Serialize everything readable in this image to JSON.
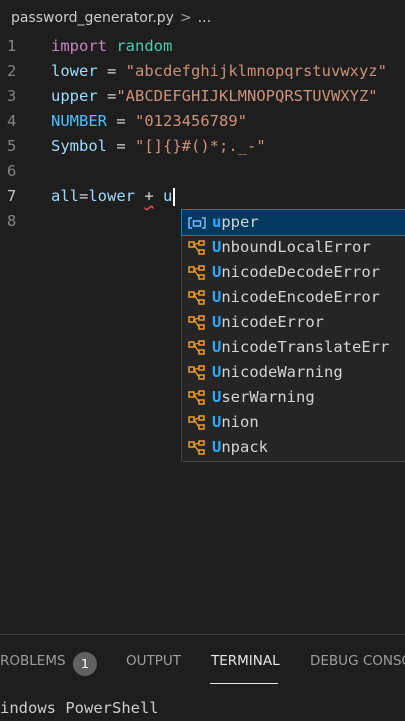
{
  "breadcrumb": {
    "file": "password_generator.py",
    "separator": ">",
    "more": "..."
  },
  "editor": {
    "lines": [
      {
        "num": "1",
        "tokens": [
          [
            "kw",
            "import"
          ],
          [
            "op",
            " "
          ],
          [
            "mod",
            "random"
          ]
        ]
      },
      {
        "num": "2",
        "tokens": [
          [
            "var",
            "lower"
          ],
          [
            "op",
            " = "
          ],
          [
            "str",
            "\"abcdefghijklmnopqrstuvwxyz\""
          ]
        ]
      },
      {
        "num": "3",
        "tokens": [
          [
            "var",
            "upper"
          ],
          [
            "op",
            " ="
          ],
          [
            "str",
            "\"ABCDEFGHIJKLMNOPQRSTUVWXYZ\""
          ]
        ]
      },
      {
        "num": "4",
        "tokens": [
          [
            "const",
            "NUMBER"
          ],
          [
            "op",
            " = "
          ],
          [
            "str",
            "\"0123456789\""
          ]
        ]
      },
      {
        "num": "5",
        "tokens": [
          [
            "var",
            "Symbol"
          ],
          [
            "op",
            " = "
          ],
          [
            "str",
            "\"[]{}#()*;._-\""
          ]
        ]
      },
      {
        "num": "6",
        "tokens": []
      },
      {
        "num": "7",
        "tokens": [
          [
            "var",
            "all"
          ],
          [
            "op",
            "="
          ],
          [
            "var",
            "lower"
          ],
          [
            "op",
            " "
          ],
          [
            "sq",
            "+"
          ],
          [
            "op",
            " "
          ],
          [
            "var",
            "u"
          ]
        ]
      },
      {
        "num": "8",
        "tokens": []
      }
    ]
  },
  "suggestions": {
    "items": [
      {
        "match": "u",
        "rest": "pper",
        "icon": "variable-icon"
      },
      {
        "match": "U",
        "rest": "nboundLocalError",
        "icon": "class-icon"
      },
      {
        "match": "U",
        "rest": "nicodeDecodeError",
        "icon": "class-icon"
      },
      {
        "match": "U",
        "rest": "nicodeEncodeError",
        "icon": "class-icon"
      },
      {
        "match": "U",
        "rest": "nicodeError",
        "icon": "class-icon"
      },
      {
        "match": "U",
        "rest": "nicodeTranslateErr",
        "icon": "class-icon"
      },
      {
        "match": "U",
        "rest": "nicodeWarning",
        "icon": "class-icon"
      },
      {
        "match": "U",
        "rest": "serWarning",
        "icon": "class-icon"
      },
      {
        "match": "U",
        "rest": "nion",
        "icon": "class-icon"
      },
      {
        "match": "U",
        "rest": "npack",
        "icon": "class-icon"
      }
    ],
    "colors": {
      "class_icon": "#ee9d28",
      "variable_icon": "#75beff",
      "match": "#2aaaff"
    }
  },
  "panel": {
    "tabs": {
      "problems": "ROBLEMS",
      "problems_count": "1",
      "output": "OUTPUT",
      "terminal": "TERMINAL",
      "debug": "DEBUG CONSO"
    },
    "terminal_text": "indows PowerShell"
  }
}
